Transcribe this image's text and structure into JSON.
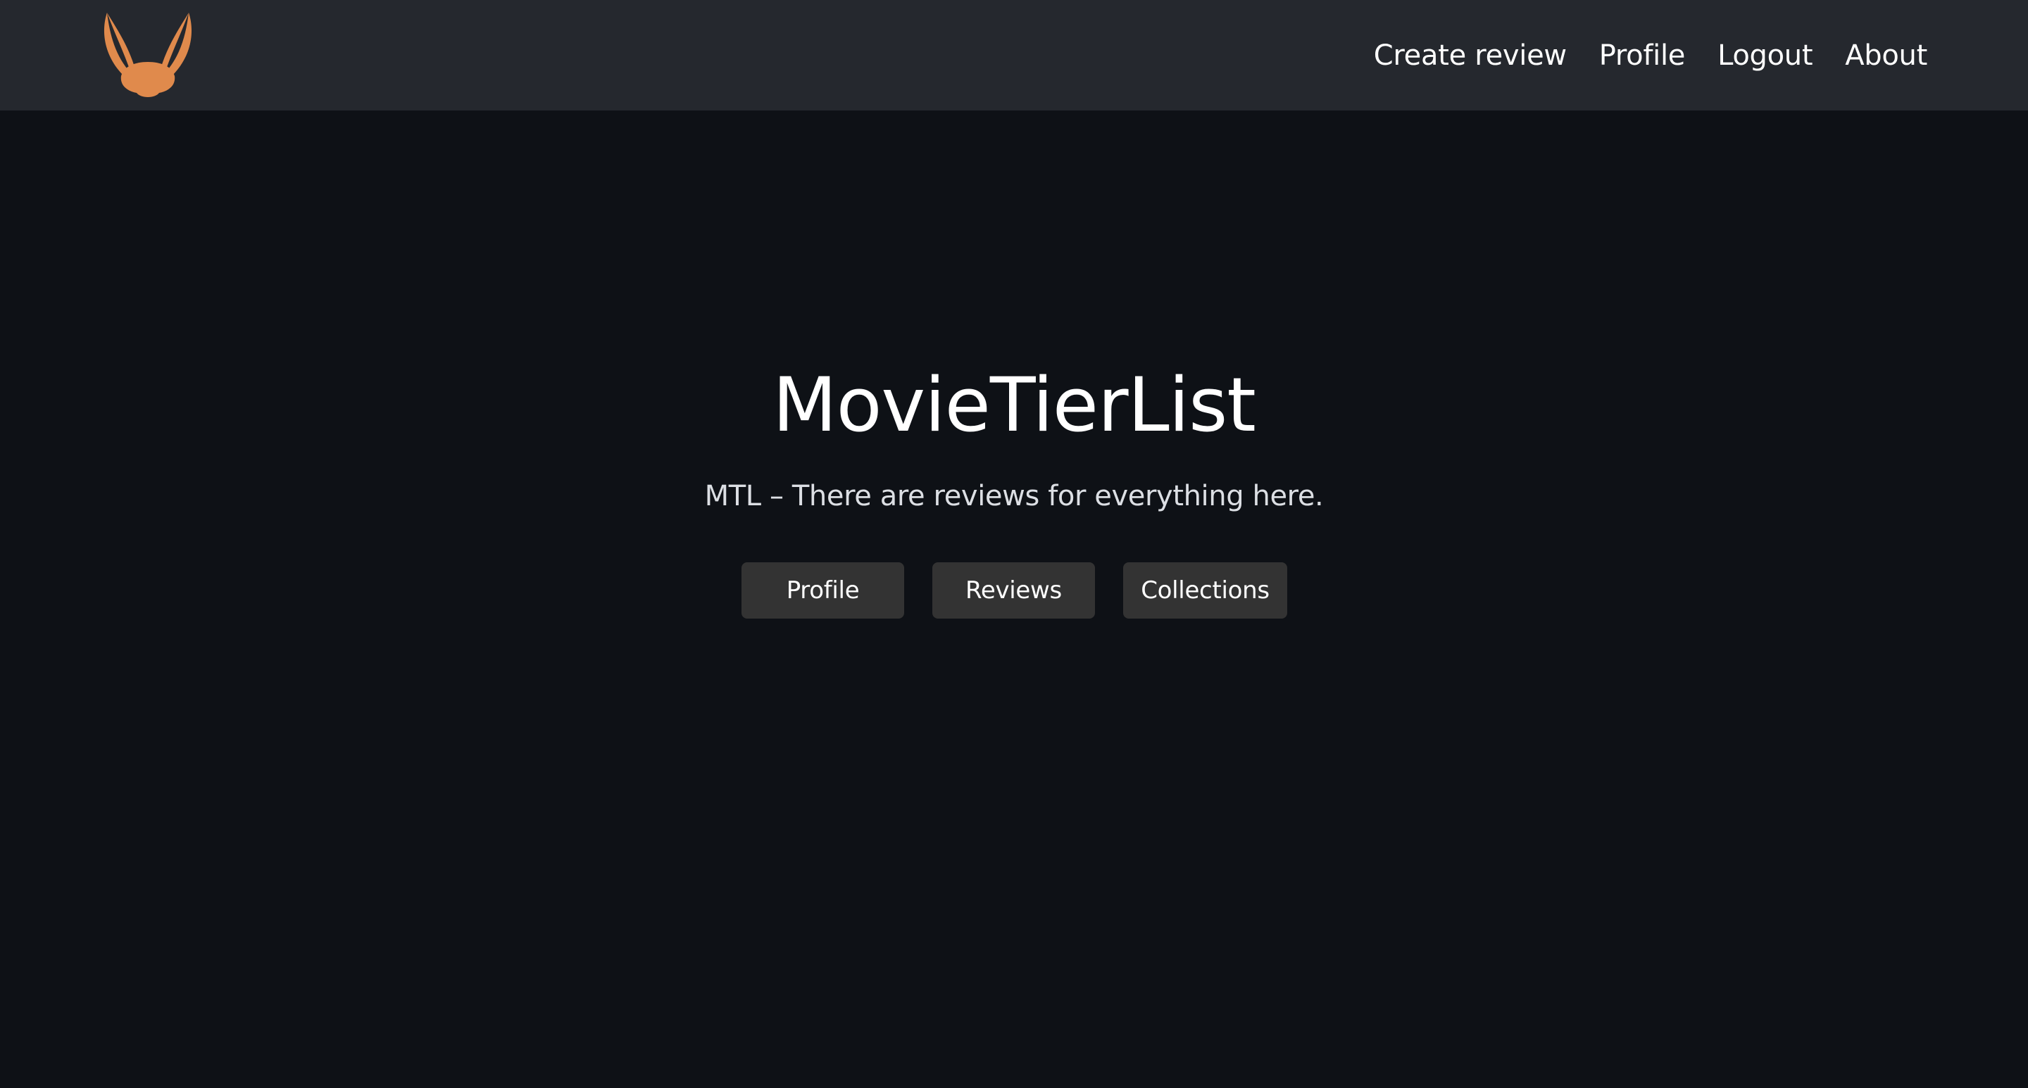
{
  "navbar": {
    "logo_icon": "fox-head-icon",
    "logo_color": "#e08a4c",
    "background": "#25282e",
    "links": [
      {
        "label": "Create review"
      },
      {
        "label": "Profile"
      },
      {
        "label": "Logout"
      },
      {
        "label": "About"
      }
    ]
  },
  "hero": {
    "title": "MovieTierList",
    "subtitle": "MTL – There are reviews for everything here.",
    "buttons": [
      {
        "label": "Profile"
      },
      {
        "label": "Reviews"
      },
      {
        "label": "Collections"
      }
    ]
  },
  "colors": {
    "page_background": "#0e1116",
    "button_background": "#333333",
    "text": "#ffffff"
  }
}
